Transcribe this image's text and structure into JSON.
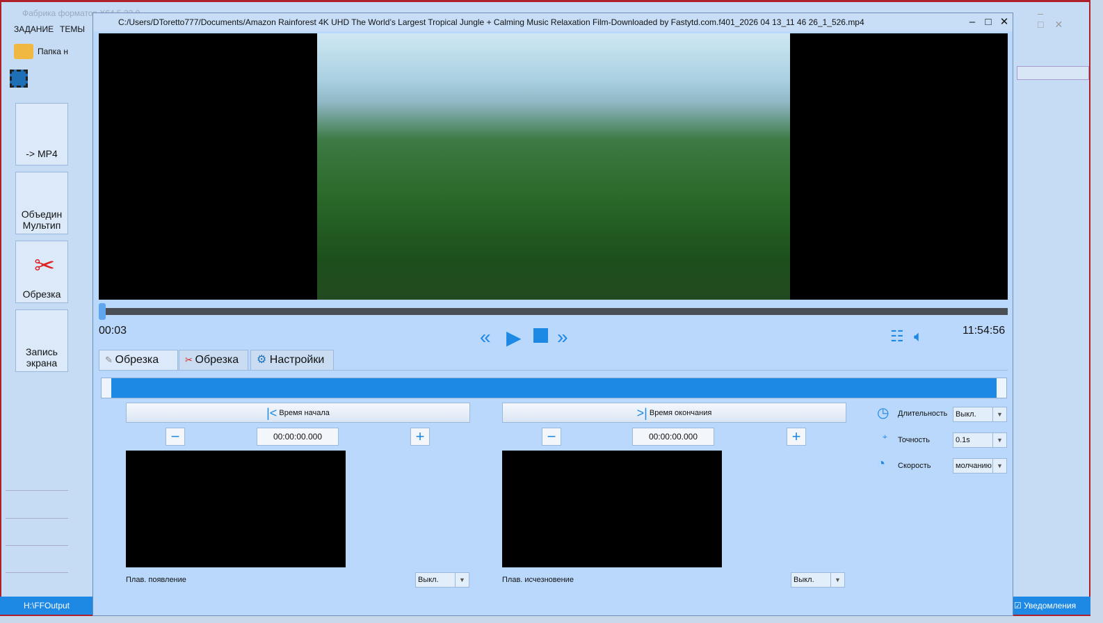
{
  "bg_app": {
    "title": "Фабрика форматов X64 5.22.0",
    "menu": [
      "ЗАДАНИЕ",
      "ТЕМЫ"
    ],
    "folder_label": "Папка н",
    "side_buttons": [
      "-> MP4",
      "Объедин Мультип",
      "Обрезка",
      "Запись экрана"
    ],
    "status": {
      "output": "H:\\FFOutput",
      "notifications": "Уведомления"
    }
  },
  "player": {
    "title": "C:/Users/DToretto777/Documents/Amazon Rainforest 4K UHD  The World’s Largest Tropical Jungle + Calming Music Relaxation Film-Downloaded by Fastytd.com.f401_2026 04 13_11 46 26_1_526.mp4",
    "current_time": "00:03",
    "total_time": "11:54:56",
    "progress": 0.0,
    "tabs": [
      "Обрезка",
      "Обрезка",
      "Настройки"
    ],
    "start": {
      "button": "Время начала",
      "time": "00:00:00.000",
      "fade_label": "Плав. появление",
      "fade_value": "Выкл."
    },
    "end": {
      "button": "Время окончания",
      "time": "00:00:00.000",
      "fade_label": "Плав. исчезновение",
      "fade_value": "Выкл."
    },
    "options": [
      {
        "label": "Длительность",
        "value": "Выкл."
      },
      {
        "label": "Точность",
        "value": "0.1s"
      },
      {
        "label": "Скорость",
        "value": "молчанию"
      }
    ]
  }
}
